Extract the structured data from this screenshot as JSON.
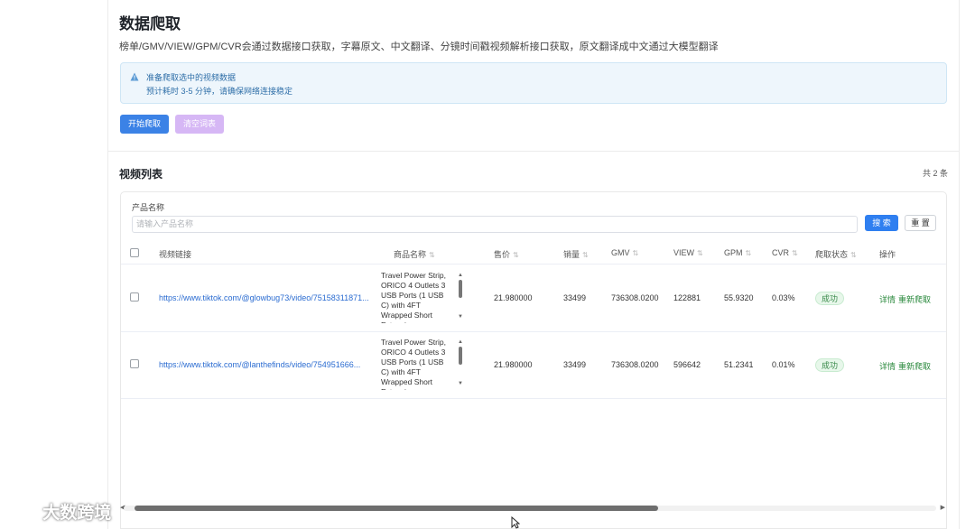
{
  "header": {
    "title": "数据爬取",
    "description": "榜单/GMV/VIEW/GPM/CVR会通过数据接口获取，字幕原文、中文翻译、分镜时间戳视频解析接口获取，原文翻译成中文通过大模型翻译"
  },
  "alert": {
    "line1": "准备爬取选中的视频数据",
    "line2": "预计耗时 3-5 分钟，请确保网络连接稳定"
  },
  "actions": {
    "start_label": "开始爬取",
    "clear_label": "清空词表"
  },
  "list": {
    "title": "视频列表",
    "count": "共 2 条"
  },
  "filter": {
    "label": "产品名称",
    "placeholder": "请输入产品名称",
    "search_label": "搜 索",
    "reset_label": "重 置"
  },
  "table": {
    "columns": [
      "视频链接",
      "商品名称",
      "售价",
      "销量",
      "GMV",
      "VIEW",
      "GPM",
      "CVR",
      "爬取状态",
      "操作"
    ],
    "rows": [
      {
        "url": "https://www.tiktok.com/@glowbug73/video/75158311871...",
        "product": "Travel Power Strip, ORICO 4 Outlets 3 USB Ports (1 USB C) with 4FT Wrapped Short Extension",
        "price": "21.980000",
        "sales": "33499",
        "gmv": "736308.0200",
        "view": "122881",
        "gpm": "55.9320",
        "cvr": "0.03%",
        "status": "成功",
        "detail": "详情",
        "recrawl": "重新爬取"
      },
      {
        "url": "https://www.tiktok.com/@lanthefinds/video/754951666...",
        "product": "Travel Power Strip, ORICO 4 Outlets 3 USB Ports (1 USB C) with 4FT Wrapped Short Extension",
        "price": "21.980000",
        "sales": "33499",
        "gmv": "736308.0200",
        "view": "596642",
        "gpm": "51.2341",
        "cvr": "0.01%",
        "status": "成功",
        "detail": "详情",
        "recrawl": "重新爬取"
      }
    ]
  },
  "watermark": "大数跨境",
  "icons": {
    "alert": "warning-icon",
    "sort": "sort-icon",
    "cursor": "mouse-cursor-icon"
  },
  "colors": {
    "primary": "#3b82e6",
    "clear_button": "#d6b7f5",
    "link": "#2b6cd1",
    "success": "#3a8a4b"
  }
}
